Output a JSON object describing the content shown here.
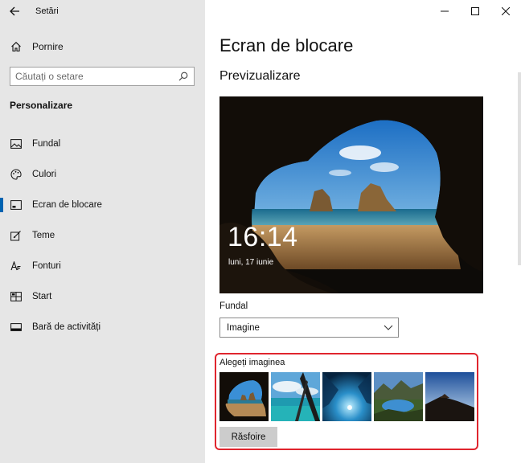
{
  "window": {
    "title": "Setări",
    "controls": {
      "minimize": "—",
      "maximize": "☐",
      "close": "✕"
    }
  },
  "sidebar": {
    "home_label": "Pornire",
    "search_placeholder": "Căutați o setare",
    "section_title": "Personalizare",
    "items": [
      {
        "label": "Fundal",
        "icon": "image-icon",
        "active": false
      },
      {
        "label": "Culori",
        "icon": "palette-icon",
        "active": false
      },
      {
        "label": "Ecran de blocare",
        "icon": "lock-screen-icon",
        "active": true
      },
      {
        "label": "Teme",
        "icon": "themes-icon",
        "active": false
      },
      {
        "label": "Fonturi",
        "icon": "fonts-icon",
        "active": false
      },
      {
        "label": "Start",
        "icon": "start-icon",
        "active": false
      },
      {
        "label": "Bară de activități",
        "icon": "taskbar-icon",
        "active": false
      }
    ]
  },
  "main": {
    "page_title": "Ecran de blocare",
    "preview_title": "Previzualizare",
    "preview_time": "16:14",
    "preview_date": "luni, 17 iunie",
    "background_label": "Fundal",
    "background_value": "Imagine",
    "choose_label": "Alegeți imaginea",
    "browse_label": "Răsfoire"
  },
  "colors": {
    "accent": "#0063b1",
    "highlight": "#e0252e",
    "sidebar_bg": "#e6e6e6"
  }
}
